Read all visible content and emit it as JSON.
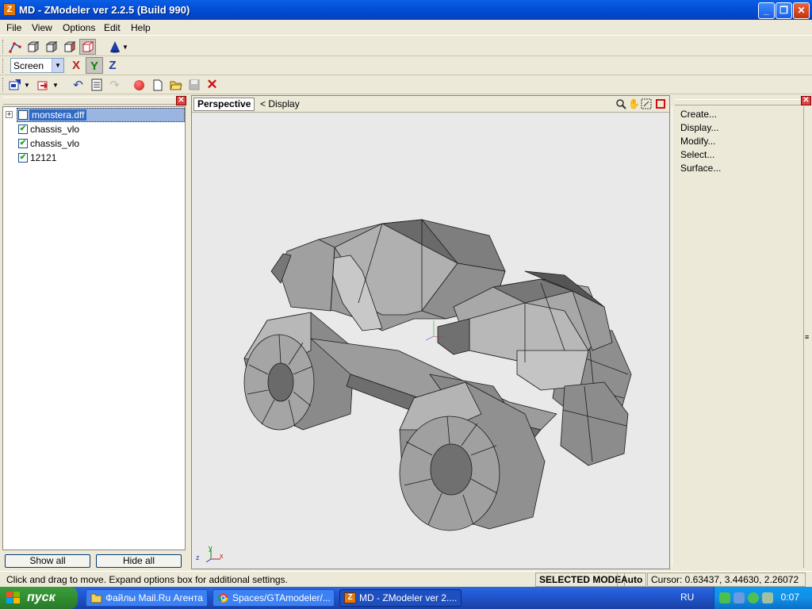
{
  "window": {
    "title": "MD - ZModeler ver 2.2.5 (Build 990)",
    "app_icon_letter": "Z",
    "minimize_icon": "minimize-icon",
    "maximize_icon": "restore-icon",
    "close_icon": "close-icon"
  },
  "menu": {
    "items": [
      "File",
      "View",
      "Options",
      "Edit",
      "Help"
    ]
  },
  "toolbar2": {
    "screen_select": "Screen",
    "axis_x": "X",
    "axis_y": "Y",
    "axis_z": "Z"
  },
  "tree": {
    "items": [
      {
        "label": "monstera.dff",
        "checked": false,
        "selected": true
      },
      {
        "label": "chassis_vlo",
        "checked": true
      },
      {
        "label": "chassis_vlo",
        "checked": true
      },
      {
        "label": "12121",
        "checked": true
      }
    ],
    "show_all": "Show all",
    "hide_all": "Hide all"
  },
  "viewport": {
    "tab": "Perspective",
    "display": "<  Display",
    "axis_labels": {
      "y": "y",
      "z": "z",
      "x": "x"
    }
  },
  "commands": {
    "items": [
      "Create...",
      "Display...",
      "Modify...",
      "Select...",
      "Surface..."
    ]
  },
  "status": {
    "message": "Click and drag to move. Expand options box for additional settings.",
    "mode": "SELECTED MODE",
    "auto": "Auto",
    "cursor": "Cursor: 0.63437, 3.44630, 2.26072"
  },
  "taskbar": {
    "start": "пуск",
    "tasks": [
      "Файлы Mail.Ru Агента",
      "Spaces/GTAmodeler/...",
      "MD - ZModeler ver 2...."
    ],
    "lang": "RU",
    "clock": "0:07"
  },
  "colors": {
    "title_blue": "#0450d8",
    "selection": "#316ac5",
    "start_green": "#2f8a2f"
  }
}
